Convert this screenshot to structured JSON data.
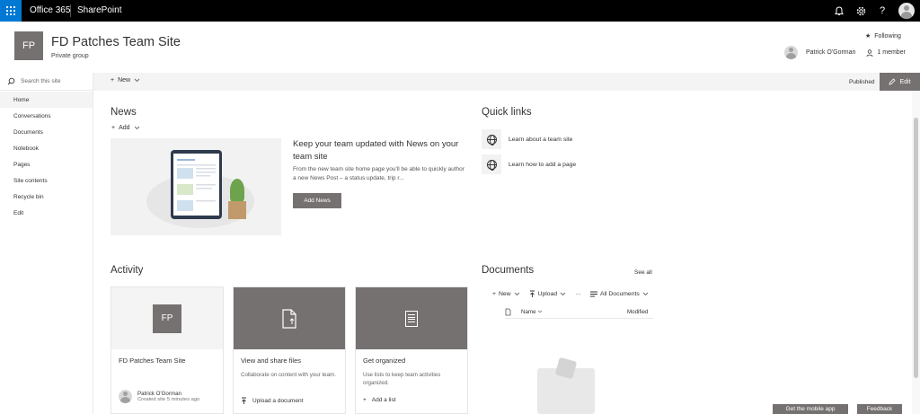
{
  "suite": {
    "brand": "Office 365",
    "app": "SharePoint",
    "icons": [
      "bell-icon",
      "gear-icon",
      "help-icon"
    ],
    "help_glyph": "?"
  },
  "site": {
    "logo_text": "FP",
    "title": "FD Patches Team Site",
    "subtitle": "Private group",
    "following": "Following",
    "owner": "Patrick O'Gorman",
    "members": "1 member"
  },
  "cmdbar": {
    "new_label": "New",
    "status": "Published",
    "edit_label": "Edit"
  },
  "nav": {
    "search_placeholder": "Search this site",
    "items": [
      {
        "label": "Home"
      },
      {
        "label": "Conversations"
      },
      {
        "label": "Documents"
      },
      {
        "label": "Notebook"
      },
      {
        "label": "Pages"
      },
      {
        "label": "Site contents"
      },
      {
        "label": "Recycle bin"
      },
      {
        "label": "Edit"
      }
    ]
  },
  "news": {
    "title": "News",
    "add_label": "Add",
    "headline": "Keep your team updated with News on your team site",
    "body": "From the new team site home page you'll be able to quickly author a new News Post – a status update, trip r...",
    "button": "Add News"
  },
  "quick_links": {
    "title": "Quick links",
    "items": [
      {
        "label": "Learn about a team site"
      },
      {
        "label": "Learn how to add a page"
      }
    ]
  },
  "activity": {
    "title": "Activity",
    "cards": [
      {
        "logo": "FP",
        "title": "FD Patches Team Site",
        "person": "Patrick O'Gorman",
        "meta": "Created site 5 minutes ago"
      },
      {
        "title": "View and share files",
        "desc": "Collaborate on content with your team.",
        "action": "Upload a document"
      },
      {
        "title": "Get organized",
        "desc": "Use lists to keep team activities organized.",
        "action": "Add a list"
      }
    ]
  },
  "documents": {
    "title": "Documents",
    "see_all": "See all",
    "cmds": {
      "new": "New",
      "upload": "Upload",
      "more": "···",
      "view": "All Documents"
    },
    "col_name": "Name",
    "col_modified": "Modified"
  },
  "footer": {
    "mobile_app": "Get the mobile app",
    "feedback": "Feedback"
  }
}
